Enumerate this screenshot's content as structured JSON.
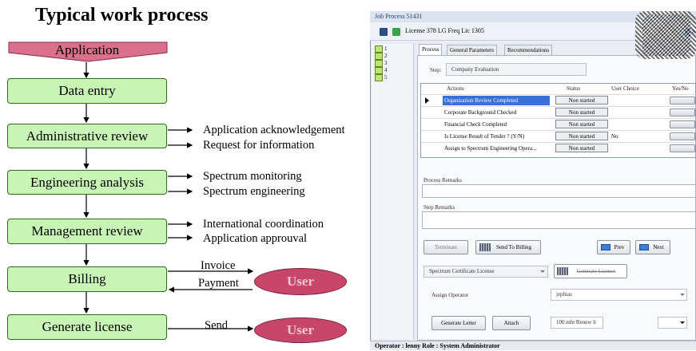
{
  "diagram": {
    "title": "Typical work process",
    "application_label": "Application",
    "steps": [
      "Data entry",
      "Administrative review",
      "Engineering analysis",
      "Management review",
      "Billing",
      "Generate license"
    ],
    "notes": {
      "administrative": [
        "Application acknowledgement",
        "Request for information"
      ],
      "engineering": [
        "Spectrum monitoring",
        "Spectrum engineering"
      ],
      "management": [
        "International coordination",
        "Application approuval"
      ]
    },
    "billing": {
      "invoice": "Invoice",
      "payment": "Payment",
      "user": "User"
    },
    "license": {
      "send": "Send",
      "user": "User"
    },
    "colors": {
      "box_fill": "#c8f5b6",
      "banner_fill": "#d9708c",
      "user_fill": "#c8466a"
    }
  },
  "app": {
    "window_title": "Job Process 51431",
    "toolbar_text": "License 378  LG Freq Lic 1305",
    "toolbar_extra": "a",
    "left_steps": [
      "1",
      "2",
      "3",
      "4",
      "5"
    ],
    "tabs": [
      "Process",
      "General Parameters",
      "Recommendations"
    ],
    "step_label": "Step:",
    "step_value": "Company Evaluation",
    "grid_headers": [
      "Actions",
      "Status",
      "User Choice",
      "Yes/No"
    ],
    "rows": [
      {
        "action": "Organization Review Completed",
        "status": "Non started",
        "choice": ""
      },
      {
        "action": "Corporate Background Checked",
        "status": "Non started",
        "choice": ""
      },
      {
        "action": "Financial Check Completed",
        "status": "Non started",
        "choice": ""
      },
      {
        "action": "Is License Result of Tender ? (Y/N)",
        "status": "Non started",
        "choice": "No"
      },
      {
        "action": "Assign to Spectrum Engineering Opera...",
        "status": "Non started",
        "choice": ""
      }
    ],
    "process_remarks": "Process Remarks",
    "step_remarks": "Step Remarks",
    "buttons": {
      "terminate": "Terminate",
      "send_to_billing": "Send To Billing",
      "prev": "Prev",
      "next": "Next",
      "generate_license": "Generate License",
      "generate_letter": "Generate Letter",
      "attach": "Attach"
    },
    "certificate_select": "Spectrum Certificate License",
    "assign_operator_label": "Assign Operator",
    "assign_operator_value": "jephias",
    "attach_file": "100.mht Renew li",
    "status_bar": "Operator :  lenny  Role :  System Administrator"
  }
}
